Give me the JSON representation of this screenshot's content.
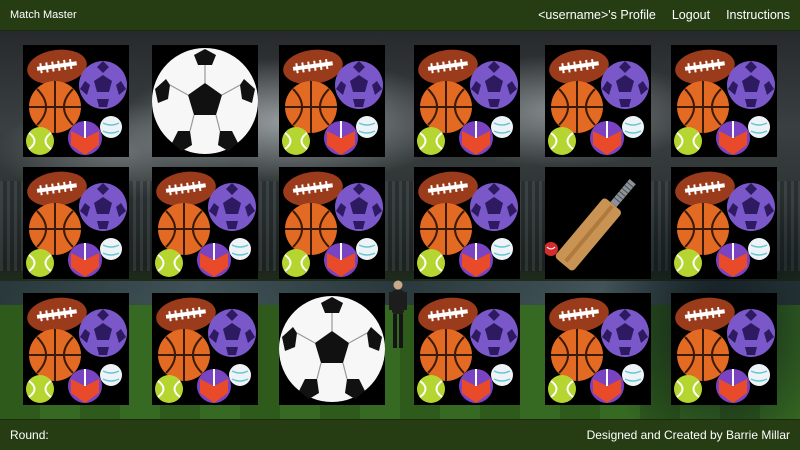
{
  "header": {
    "brand": "Match Master",
    "nav": [
      {
        "label": "<username>'s Profile",
        "name": "profile-link"
      },
      {
        "label": "Logout",
        "name": "logout-link"
      },
      {
        "label": "Instructions",
        "name": "instructions-link"
      }
    ]
  },
  "footer": {
    "round_label": "Round:",
    "credit": "Designed and Created by Barrie Millar"
  },
  "board": {
    "rows": 3,
    "cols": 6,
    "cards": [
      "card-back",
      "soccer-ball-icon",
      "card-back",
      "card-back",
      "card-back",
      "card-back",
      "card-back",
      "card-back",
      "card-back",
      "card-back",
      "cricket-bat-icon",
      "card-back",
      "card-back",
      "card-back",
      "soccer-ball-icon",
      "card-back",
      "card-back",
      "card-back"
    ]
  },
  "colors": {
    "bar": "#263d14",
    "card_bg": "#000000",
    "pitch": "#2e5a1c"
  }
}
